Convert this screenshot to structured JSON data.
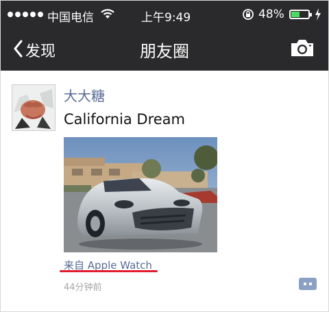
{
  "status_bar": {
    "carrier": "中国电信",
    "time": "上午9:49",
    "battery_percent": "48%",
    "battery_level": 0.48,
    "icons": [
      "signal-dots-icon",
      "wifi-icon",
      "rotation-lock-icon",
      "battery-icon",
      "charging-bolt-icon"
    ]
  },
  "nav": {
    "back_label": "发现",
    "title": "朋友圈",
    "camera_icon": "camera-icon"
  },
  "post": {
    "author": "大大糖",
    "text": "California Dream",
    "source": "来自 Apple Watch",
    "time": "44分钟前",
    "comment_icon": "comment-icon"
  },
  "colors": {
    "bar_bg": "#2a2a2c",
    "link": "#576b95",
    "underline": "#e21b2d",
    "battery_fill": "#4cd964"
  }
}
